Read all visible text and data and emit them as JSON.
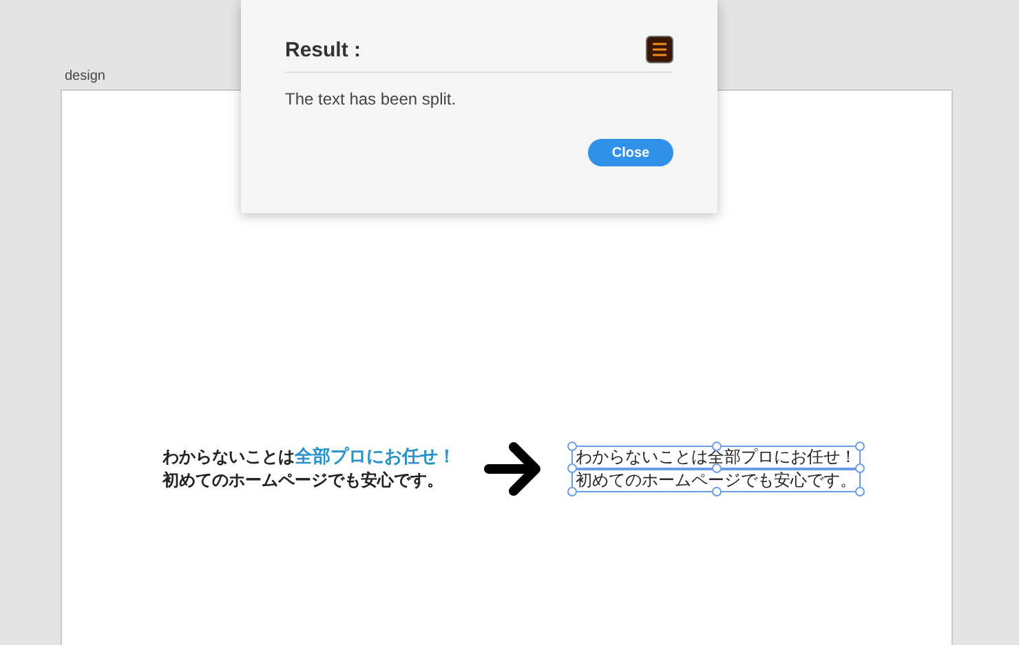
{
  "artboard": {
    "label": "design",
    "source_text": {
      "lines": [
        [
          {
            "text": "わからないことは",
            "highlight": false
          },
          {
            "text": "全部プロにお任せ！",
            "highlight": true
          }
        ],
        [
          {
            "text": "初めてのホームページでも安心です。",
            "highlight": false
          }
        ]
      ]
    },
    "split_text": [
      {
        "text": "わからないことは全部プロにお任せ！",
        "selected": true
      },
      {
        "text": "初めてのホームページでも安心です。",
        "selected": true
      }
    ]
  },
  "dialog": {
    "title": "Result :",
    "message": "The text has been split.",
    "button": "Close"
  }
}
